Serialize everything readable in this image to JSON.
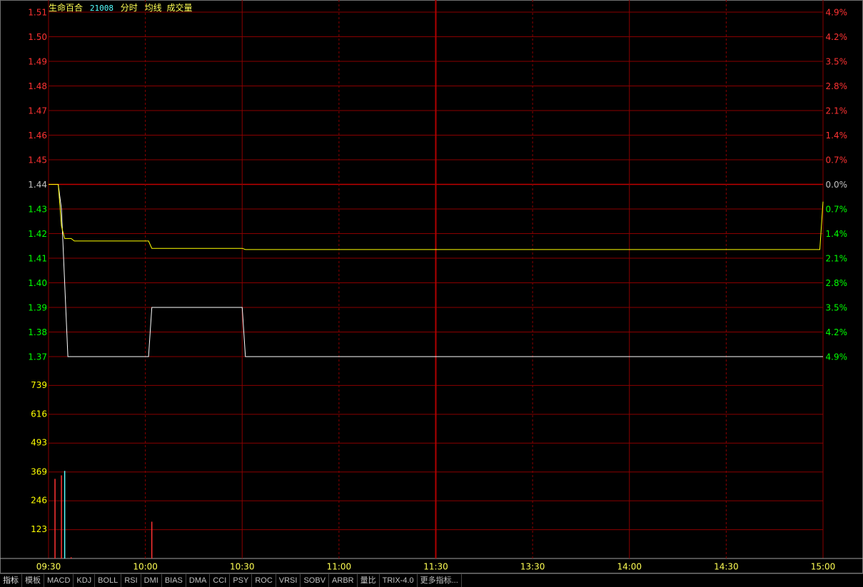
{
  "header": {
    "stock_name": "生命百合",
    "stock_code": "21008",
    "labels": [
      "分时",
      "均线",
      "成交量"
    ]
  },
  "colors": {
    "background": "#000000",
    "grid": "#8a0000",
    "up": "#ff3232",
    "down": "#00ff00",
    "flat": "#c0c0c0",
    "price_line": "#ffffff",
    "avg_line": "#ffff00",
    "volume_axis": "#ffff00"
  },
  "chart_data": {
    "type": "line",
    "prev_close": 1.44,
    "price_axis": {
      "ticks": [
        "1.51",
        "1.50",
        "1.49",
        "1.48",
        "1.47",
        "1.46",
        "1.45",
        "1.44",
        "1.43",
        "1.42",
        "1.41",
        "1.40",
        "1.39",
        "1.38",
        "1.37"
      ],
      "ylim": [
        1.37,
        1.51
      ]
    },
    "pct_axis": {
      "ticks": [
        "4.9%",
        "4.2%",
        "3.5%",
        "2.8%",
        "2.1%",
        "1.4%",
        "0.7%",
        "0.0%",
        "0.7%",
        "1.4%",
        "2.1%",
        "2.8%",
        "3.5%",
        "4.2%",
        "4.9%"
      ]
    },
    "volume_axis": {
      "ticks": [
        "739",
        "616",
        "493",
        "369",
        "246",
        "123"
      ],
      "ylim": [
        0,
        862
      ]
    },
    "time_axis": {
      "ticks": [
        "09:30",
        "10:00",
        "10:30",
        "11:00",
        "11:30",
        "13:30",
        "14:00",
        "14:30",
        "15:00"
      ],
      "minutes_total": 240
    },
    "series": [
      {
        "name": "分时",
        "points": [
          [
            0,
            1.44
          ],
          [
            3,
            1.44
          ],
          [
            4,
            1.43
          ],
          [
            5,
            1.4
          ],
          [
            6,
            1.37
          ],
          [
            31,
            1.37
          ],
          [
            32,
            1.39
          ],
          [
            60,
            1.39
          ],
          [
            61,
            1.37
          ],
          [
            240,
            1.37
          ]
        ]
      },
      {
        "name": "均线",
        "points": [
          [
            0,
            1.44
          ],
          [
            3,
            1.44
          ],
          [
            4,
            1.423
          ],
          [
            5,
            1.418
          ],
          [
            7,
            1.418
          ],
          [
            8,
            1.417
          ],
          [
            31,
            1.417
          ],
          [
            32,
            1.414
          ],
          [
            60,
            1.414
          ],
          [
            61,
            1.4135
          ],
          [
            239,
            1.4135
          ],
          [
            240,
            1.433
          ]
        ]
      }
    ],
    "volume": [
      {
        "minute": 2,
        "value": 340,
        "dir": "up"
      },
      {
        "minute": 4,
        "value": 355,
        "dir": "up"
      },
      {
        "minute": 5,
        "value": 374,
        "dir": "down"
      },
      {
        "minute": 7,
        "value": 5,
        "dir": "up"
      },
      {
        "minute": 32,
        "value": 157,
        "dir": "up"
      }
    ]
  },
  "tabs": [
    "指标",
    "模板",
    "MACD",
    "KDJ",
    "BOLL",
    "RSI",
    "DMI",
    "BIAS",
    "DMA",
    "CCI",
    "PSY",
    "ROC",
    "VRSI",
    "SOBV",
    "ARBR",
    "量比",
    "TRIX-4.0",
    "更多指标..."
  ]
}
